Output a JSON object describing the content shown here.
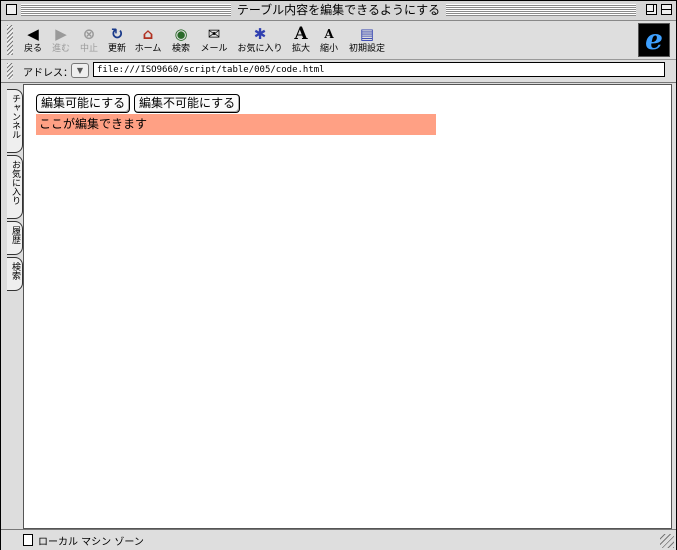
{
  "window": {
    "title": "テーブル内容を編集できるようにする"
  },
  "toolbar": {
    "buttons": [
      {
        "label": "戻る",
        "icon": "back-arrow-icon",
        "glyph": "◀"
      },
      {
        "label": "進む",
        "icon": "forward-arrow-icon",
        "glyph": "▶"
      },
      {
        "label": "中止",
        "icon": "stop-icon",
        "glyph": "⊗"
      },
      {
        "label": "更新",
        "icon": "refresh-icon",
        "glyph": "↻"
      },
      {
        "label": "ホーム",
        "icon": "home-icon",
        "glyph": "⌂"
      },
      {
        "label": "検索",
        "icon": "search-icon",
        "glyph": "◉"
      },
      {
        "label": "メール",
        "icon": "mail-icon",
        "glyph": "✉"
      },
      {
        "label": "お気に入り",
        "icon": "favorites-icon",
        "glyph": "✱"
      },
      {
        "label": "拡大",
        "icon": "larger-text-icon",
        "glyph": "A"
      },
      {
        "label": "縮小",
        "icon": "smaller-text-icon",
        "glyph": "A"
      },
      {
        "label": "初期設定",
        "icon": "preferences-icon",
        "glyph": "▤"
      }
    ]
  },
  "address": {
    "label": "アドレス：",
    "url": "file:///ISO9660/script/table/005/code.html"
  },
  "sidebar": {
    "tabs": [
      {
        "label": "チャンネル"
      },
      {
        "label": "お気に入り"
      },
      {
        "label": "履歴"
      },
      {
        "label": "検索"
      }
    ]
  },
  "page": {
    "enable_button": "編集可能にする",
    "disable_button": "編集不可能にする",
    "editable_text": "ここが編集できます",
    "editable_bg": "#ffa084"
  },
  "status": {
    "zone": "ローカル マシン ゾーン"
  }
}
